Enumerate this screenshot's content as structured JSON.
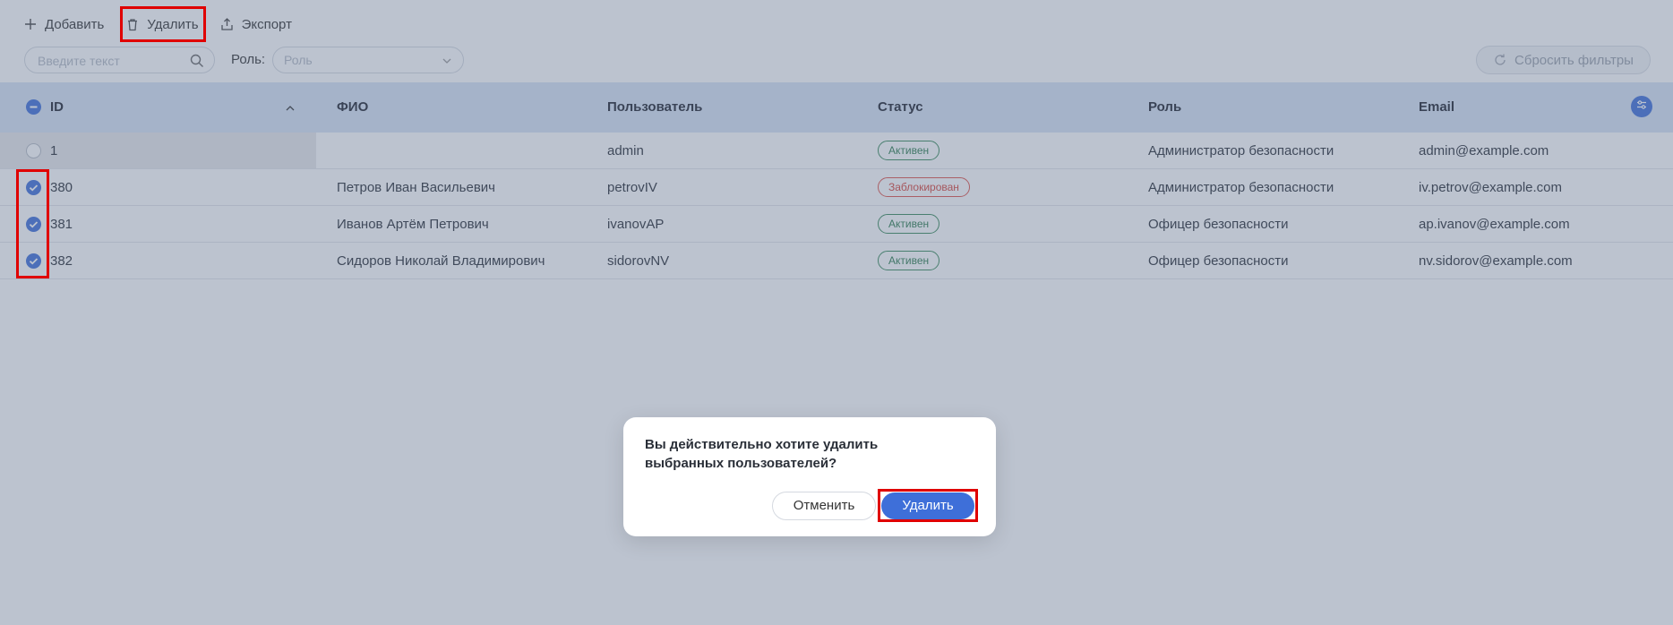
{
  "toolbar": {
    "add_label": "Добавить",
    "delete_label": "Удалить",
    "export_label": "Экспорт"
  },
  "filters": {
    "search_placeholder": "Введите текст",
    "role_label": "Роль:",
    "role_placeholder": "Роль",
    "reset_label": "Сбросить фильтры"
  },
  "table": {
    "columns": [
      "ID",
      "ФИО",
      "Пользователь",
      "Статус",
      "Роль",
      "Email"
    ],
    "rows": [
      {
        "id": "1",
        "fio": "",
        "user": "admin",
        "status": "Активен",
        "role": "Администратор безопасности",
        "email": "admin@example.com",
        "checked": false
      },
      {
        "id": "380",
        "fio": "Петров Иван Васильевич",
        "user": "petrovIV",
        "status": "Заблокирован",
        "role": "Администратор безопасности",
        "email": "iv.petrov@example.com",
        "checked": true
      },
      {
        "id": "381",
        "fio": "Иванов Артём Петрович",
        "user": "ivanovAP",
        "status": "Активен",
        "role": "Офицер безопасности",
        "email": "ap.ivanov@example.com",
        "checked": true
      },
      {
        "id": "382",
        "fio": "Сидоров Николай Владимирович",
        "user": "sidorovNV",
        "status": "Активен",
        "role": "Офицер безопасности",
        "email": "nv.sidorov@example.com",
        "checked": true
      }
    ]
  },
  "dialog": {
    "message": "Вы действительно хотите удалить выбранных пользователей?",
    "cancel_label": "Отменить",
    "confirm_label": "Удалить"
  },
  "colors": {
    "accent": "#3e6fd9",
    "header_bg": "#d7e4f5",
    "active": "#2e7d4f",
    "blocked": "#d9453b",
    "highlight": "#e00000"
  }
}
